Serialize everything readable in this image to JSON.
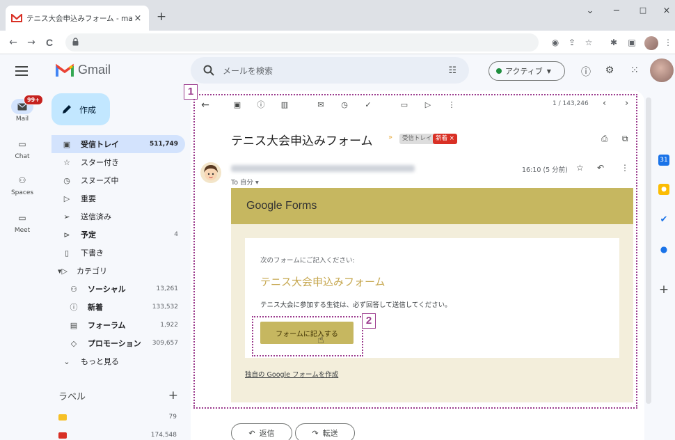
{
  "browser": {
    "tab_title": "テニス大会申込みフォーム - makotoi",
    "tab_close": "×",
    "new_tab": "+",
    "back": "←",
    "forward": "→",
    "reload": "C",
    "window_minimize": "−",
    "window_maximize": "□",
    "window_close": "×",
    "window_menu": "⌄"
  },
  "gmail": {
    "logo_text": "Gmail",
    "compose_label": "作成",
    "rail": [
      {
        "label": "Mail",
        "badge": "99+"
      },
      {
        "label": "Chat"
      },
      {
        "label": "Spaces"
      },
      {
        "label": "Meet"
      }
    ],
    "nav": [
      {
        "label": "受信トレイ",
        "count": "511,749"
      },
      {
        "label": "スター付き",
        "count": ""
      },
      {
        "label": "スヌーズ中",
        "count": ""
      },
      {
        "label": "重要",
        "count": ""
      },
      {
        "label": "送信済み",
        "count": ""
      },
      {
        "label": "予定",
        "count": "4"
      },
      {
        "label": "下書き",
        "count": ""
      },
      {
        "label": "カテゴリ",
        "count": ""
      },
      {
        "label": "ソーシャル",
        "count": "13,261"
      },
      {
        "label": "新着",
        "count": "133,532"
      },
      {
        "label": "フォーラム",
        "count": "1,922"
      },
      {
        "label": "プロモーション",
        "count": "309,657"
      },
      {
        "label": "もっと見る",
        "count": ""
      }
    ],
    "labels_title": "ラベル",
    "labels_plus": "+",
    "labels": [
      {
        "count": "79",
        "color": "#f6c026"
      },
      {
        "count": "174,548",
        "color": "#d93025"
      }
    ],
    "search_placeholder": "メールを検索",
    "status_label": "アクティブ"
  },
  "email": {
    "pager": "1 / 143,246",
    "subject": "テニス大会申込みフォーム",
    "label_inbox": "受信トレイ ×",
    "label_new": "新着 ×",
    "to_me": "To 自分 ▾",
    "time": "16:10 (5 分前)",
    "forms_brand": "Google Forms",
    "forms_intro": "次のフォームにご記入ください:",
    "forms_title": "テニス大会申込みフォーム",
    "forms_desc": "テニス大会に参加する生徒は、必ず回答して送信してください。",
    "forms_button": "フォームに記入する",
    "forms_link": "独自の Google フォームを作成",
    "reply_label": "返信",
    "forward_label": "転送"
  },
  "annotations": {
    "box1": "1",
    "box2": "2"
  },
  "colors": {
    "accent": "#c6b760",
    "annotation": "#9b3a8d",
    "gmail_active": "#d3e3fd"
  }
}
